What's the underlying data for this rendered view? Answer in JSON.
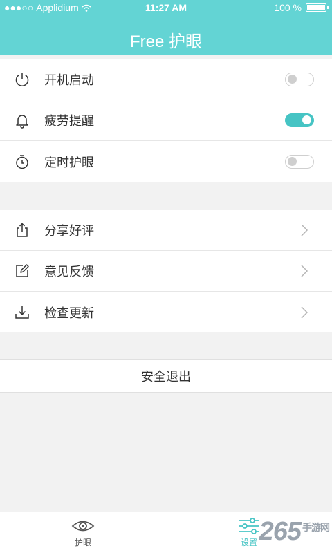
{
  "status_bar": {
    "carrier": "Applidium",
    "time": "11:27 AM",
    "battery": "100 %"
  },
  "header": {
    "title": "Free 护眼"
  },
  "settings_group_1": [
    {
      "label": "开机启动",
      "icon": "power-icon",
      "toggle": false
    },
    {
      "label": "疲劳提醒",
      "icon": "bell-icon",
      "toggle": true
    },
    {
      "label": "定时护眼",
      "icon": "timer-icon",
      "toggle": false
    }
  ],
  "settings_group_2": [
    {
      "label": "分享好评",
      "icon": "share-icon"
    },
    {
      "label": "意见反馈",
      "icon": "edit-icon"
    },
    {
      "label": "检查更新",
      "icon": "download-icon"
    }
  ],
  "logout_label": "安全退出",
  "tabs": [
    {
      "label": "护眼",
      "icon": "eye-icon",
      "active": false
    },
    {
      "label": "设置",
      "icon": "sliders-icon",
      "active": true
    }
  ],
  "watermark": {
    "main": "265",
    "sub": "手游网"
  },
  "colors": {
    "accent": "#63d4d4",
    "toggle_on": "#46c4c4"
  }
}
